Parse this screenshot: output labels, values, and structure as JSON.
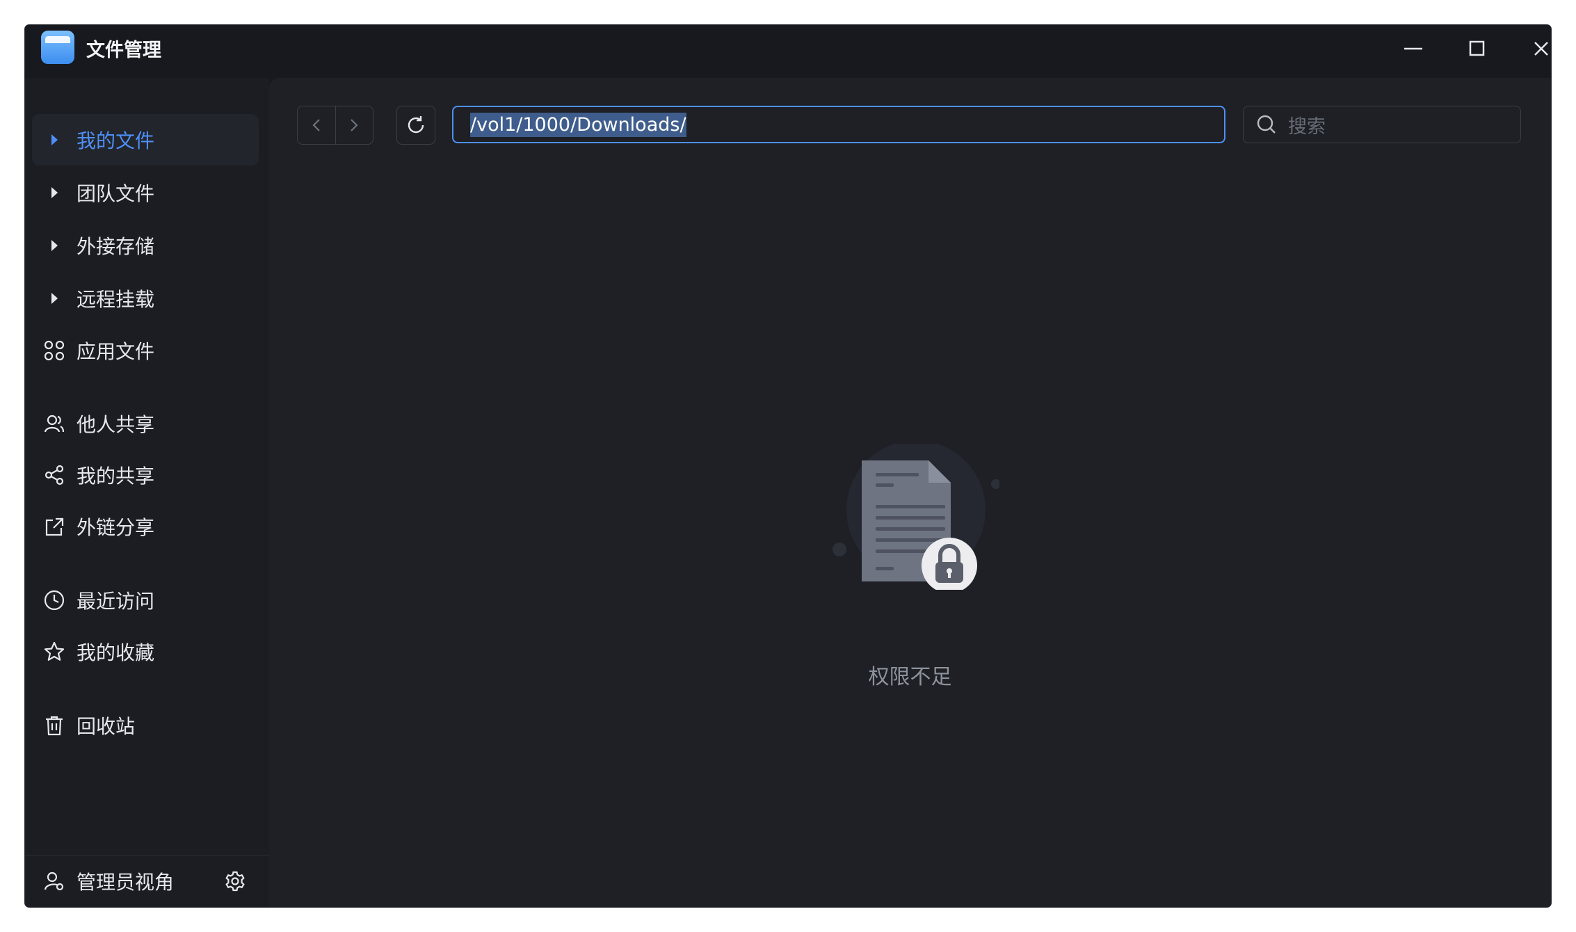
{
  "window": {
    "title": "文件管理",
    "controls": [
      "minimize",
      "maximize",
      "close"
    ]
  },
  "sidebar": {
    "items": [
      {
        "label": "我的文件",
        "icon": "caret-right-icon",
        "active": true
      },
      {
        "label": "团队文件",
        "icon": "caret-right-icon"
      },
      {
        "label": "外接存储",
        "icon": "caret-right-icon"
      },
      {
        "label": "远程挂载",
        "icon": "caret-right-icon"
      },
      {
        "label": "应用文件",
        "icon": "apps-grid-icon"
      },
      {
        "label": "他人共享",
        "icon": "users-icon"
      },
      {
        "label": "我的共享",
        "icon": "share-icon"
      },
      {
        "label": "外链分享",
        "icon": "external-link-icon"
      },
      {
        "label": "最近访问",
        "icon": "clock-icon"
      },
      {
        "label": "我的收藏",
        "icon": "star-icon"
      },
      {
        "label": "回收站",
        "icon": "trash-icon"
      }
    ],
    "footer": {
      "label": "管理员视角",
      "icon": "admin-user-icon",
      "settings_icon": "gear-icon"
    }
  },
  "toolbar": {
    "path": "/vol1/1000/Downloads/",
    "search_placeholder": "搜索"
  },
  "content": {
    "empty_message": "权限不足",
    "empty_icon": "locked-document-icon"
  },
  "colors": {
    "accent": "#4f8ff7",
    "background": "#1e2026",
    "sidebar": "#1b1d22"
  }
}
